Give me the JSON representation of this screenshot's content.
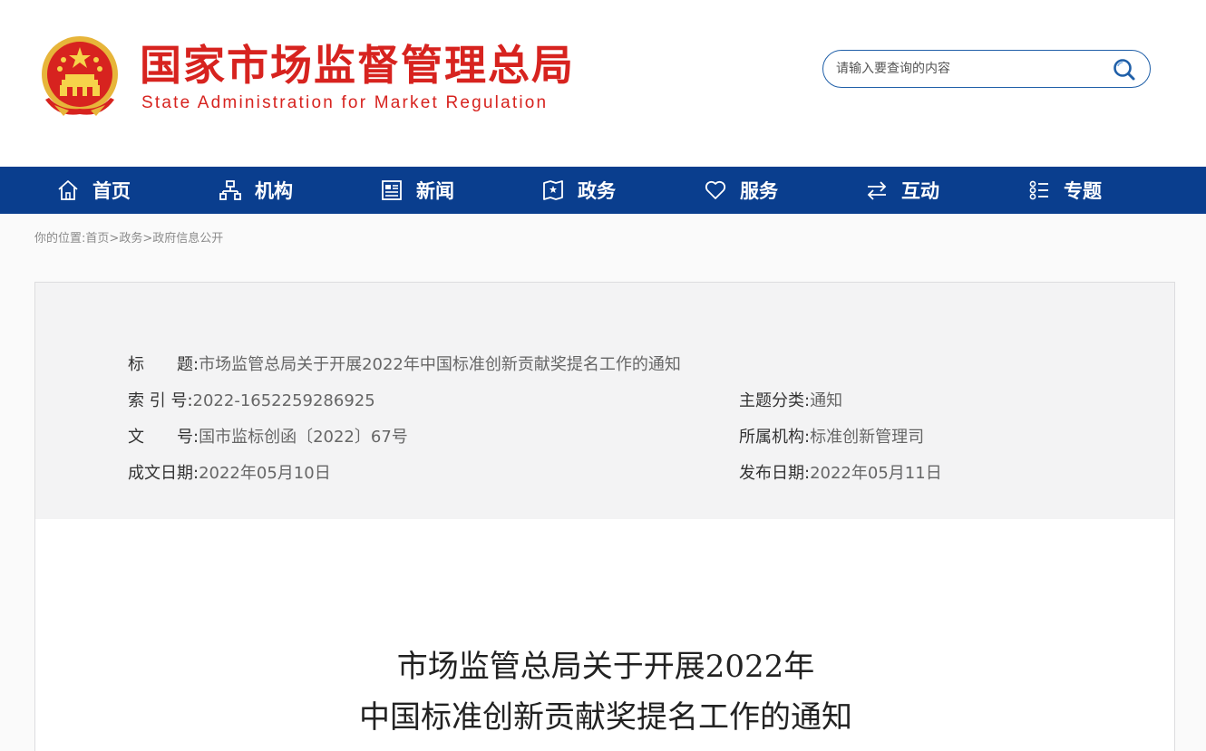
{
  "header": {
    "site_title": "国家市场监督管理总局",
    "site_subtitle": "State Administration for Market Regulation",
    "search": {
      "placeholder": "请输入要查询的内容",
      "value": ""
    }
  },
  "nav": {
    "items": [
      {
        "label": "首页",
        "icon": "home-icon"
      },
      {
        "label": "机构",
        "icon": "org-chart-icon"
      },
      {
        "label": "新闻",
        "icon": "newspaper-icon"
      },
      {
        "label": "政务",
        "icon": "government-affairs-icon"
      },
      {
        "label": "服务",
        "icon": "heart-icon"
      },
      {
        "label": "互动",
        "icon": "exchange-arrows-icon"
      },
      {
        "label": "专题",
        "icon": "topic-list-icon"
      }
    ]
  },
  "breadcrumb": {
    "prefix": "你的位置:",
    "items": [
      "首页",
      "政务",
      "政府信息公开"
    ],
    "separator": ">"
  },
  "info": {
    "title_label": "标　　题:",
    "title_value": "市场监管总局关于开展2022年中国标准创新贡献奖提名工作的通知",
    "index_label": "索 引 号:",
    "index_value": "2022-1652259286925",
    "category_label": "主题分类:",
    "category_value": "通知",
    "docno_label": "文　　号:",
    "docno_value": "国市监标创函〔2022〕67号",
    "org_label": "所属机构:",
    "org_value": "标准创新管理司",
    "date_written_label": "成文日期:",
    "date_written_value": "2022年05月10日",
    "date_published_label": "发布日期:",
    "date_published_value": "2022年05月11日"
  },
  "document": {
    "title_line1": "市场监管总局关于开展2022年",
    "title_line2": "中国标准创新贡献奖提名工作的通知"
  },
  "colors": {
    "brand_red": "#d7231f",
    "nav_blue": "#0a3e8e",
    "search_border": "#1f5fa8"
  }
}
